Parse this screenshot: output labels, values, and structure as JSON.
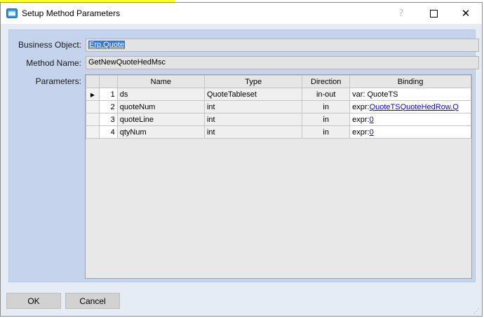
{
  "window": {
    "title": "Setup Method Parameters",
    "help_glyph": "?",
    "close_glyph": "✕"
  },
  "form": {
    "business_object_label": "Business Object:",
    "business_object_value": "Erp.Quote",
    "method_name_label": "Method Name:",
    "method_name_value": "GetNewQuoteHedMsc",
    "parameters_label": "Parameters:"
  },
  "grid": {
    "columns": [
      "",
      "",
      "Name",
      "Type",
      "Direction",
      "Binding"
    ],
    "current_row_marker": "▶",
    "rows": [
      {
        "num": "1",
        "name": "ds",
        "type": "QuoteTableset",
        "direction": "in-out",
        "binding_prefix": "var: QuoteTS",
        "binding_link": ""
      },
      {
        "num": "2",
        "name": "quoteNum",
        "type": "int",
        "direction": "in",
        "binding_prefix": "expr:",
        "binding_link": "QuoteTSQuoteHedRow.Q"
      },
      {
        "num": "3",
        "name": "quoteLine",
        "type": "int",
        "direction": "in",
        "binding_prefix": "expr:",
        "binding_link": "0"
      },
      {
        "num": "4",
        "name": "qtyNum",
        "type": "int",
        "direction": "in",
        "binding_prefix": "expr:",
        "binding_link": "0"
      }
    ]
  },
  "buttons": {
    "ok": "OK",
    "cancel": "Cancel"
  }
}
